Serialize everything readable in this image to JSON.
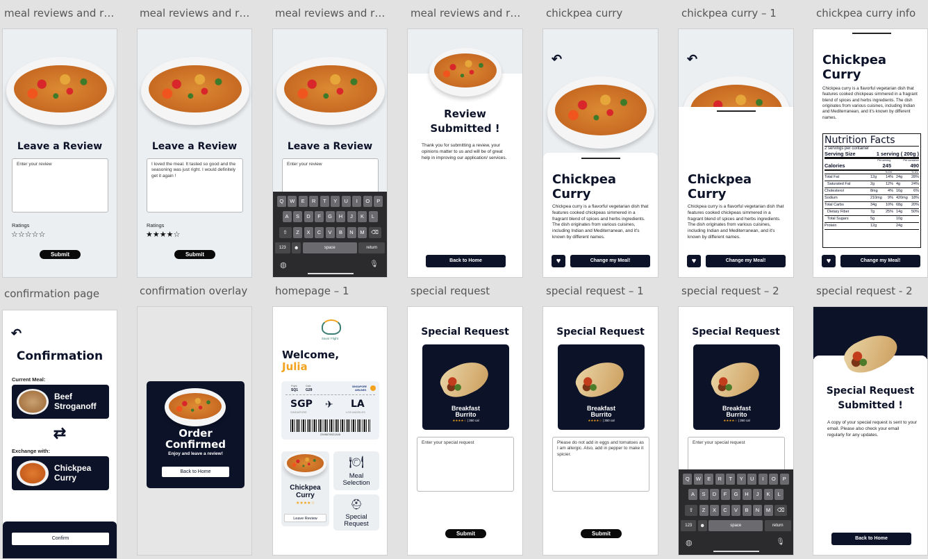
{
  "labels": {
    "r1": [
      "meal reviews and rati...",
      "meal reviews and rati...",
      "meal reviews and rati...",
      "meal reviews and rati...",
      "chickpea curry",
      "chickpea curry – 1",
      "chickpea curry info"
    ],
    "r2": [
      "confirmation page",
      "confirmation overlay",
      "homepage – 1",
      "special request",
      "special request – 1",
      "special request – 2",
      "special request - 2"
    ]
  },
  "review": {
    "title": "Leave a Review",
    "placeholder": "Enter your review",
    "filled_text": "I loved the meal. It tasted so good and the seasoning was just right. I would definitely get it again !",
    "ratings_label": "Ratings",
    "stars_empty": "☆☆☆☆☆",
    "stars_filled": "★★★★☆",
    "submit": "Submit"
  },
  "keyboard": {
    "row1": [
      "Q",
      "W",
      "E",
      "R",
      "T",
      "Y",
      "U",
      "I",
      "O",
      "P"
    ],
    "row2": [
      "A",
      "S",
      "D",
      "F",
      "G",
      "H",
      "J",
      "K",
      "L"
    ],
    "row3": [
      "Z",
      "X",
      "C",
      "V",
      "B",
      "N",
      "M"
    ],
    "num": "123",
    "space": "space",
    "return": "return"
  },
  "submitted": {
    "title_line1": "Review",
    "title_line2": "Submitted !",
    "body": "Thank you for submitting a review, your opinions matter to us and will be of great help in improving our application/ services.",
    "back": "Back to Home"
  },
  "curry": {
    "title_line1": "Chickpea",
    "title_line2": "Curry",
    "desc": "Chickpea curry is a flavorful vegetarian dish that features cooked chickpeas simmered in a fragrant blend of spices and herbs ingredients. The dish originates from various cuisines, including Indian and Mediterranean, and it's known by different names.",
    "change": "Change my Meal!",
    "heart": "♥"
  },
  "nutrition": {
    "title": "Nutrition Facts",
    "servings": "2 servings per container",
    "serving_size_label": "Serving Size",
    "serving_size_value": "1 serving ( 200g )",
    "per_serving": "Per serving",
    "per_container": "Per container",
    "calories_label": "Calories",
    "calories_a": "245",
    "calories_b": "490",
    "dv": "% DV",
    "rows": [
      [
        "Total Fat",
        "12g",
        "14%",
        "24g",
        "28%"
      ],
      [
        "Saturated Fat",
        "2g",
        "12%",
        "4g",
        "24%"
      ],
      [
        "Cholesterol",
        "8mg",
        "4%",
        "16g",
        "6%"
      ],
      [
        "Sodium",
        "210mg",
        "9%",
        "420mg",
        "18%"
      ],
      [
        "Total Carbs",
        "34g",
        "10%",
        "68g",
        "20%"
      ],
      [
        "Dietary Fiber",
        "7g",
        "25%",
        "14g",
        "50%"
      ],
      [
        "Total Sugars",
        "5g",
        "",
        "10g",
        ""
      ],
      [
        "Protein",
        "12g",
        "",
        "24g",
        ""
      ]
    ]
  },
  "confirmation": {
    "title": "Confirmation",
    "current_label": "Current Meal:",
    "current_meal_l1": "Beef",
    "current_meal_l2": "Stroganoff",
    "exchange_label": "Exchange with:",
    "exchange_meal_l1": "Chickpea",
    "exchange_meal_l2": "Curry",
    "swap_icon": "⇄",
    "confirm": "Confirm"
  },
  "overlay": {
    "title_l1": "Order",
    "title_l2": "Confirmed",
    "sub": "Enjoy and leave a review!",
    "back": "Back to Home"
  },
  "home": {
    "brand": "Savor Flight",
    "welcome": "Welcome,",
    "name": "Julia",
    "flight_label": "Flight",
    "flight": "SQ1",
    "gate_label": "Gate",
    "gate": "G29",
    "airline_l1": "SINGAPORE",
    "airline_l2": "AIRLINES",
    "from_code": "SGP",
    "from_city": "SINGAPORE",
    "to_code": "LA",
    "to_city": "LOS ANGELES",
    "barcode_num": "2345678921345",
    "meal_name_l1": "Chickpea",
    "meal_name_l2": "Curry",
    "meal_stars": "★★★★☆",
    "leave_review": "Leave Review",
    "meal_sel_l1": "Meal",
    "meal_sel_l2": "Selection",
    "special_l1": "Special",
    "special_l2": "Request"
  },
  "special": {
    "title": "Special Request",
    "card_l1": "Breakfast",
    "card_l2": "Burrito",
    "card_stars": "★★★★☆",
    "card_kcal": "| 350 cal",
    "placeholder": "Enter your special request",
    "filled": "Please do not add in eggs and tomatoes as I am allergic. Also, add in pepper to make it spicier.",
    "submit": "Submit",
    "sub_title_l1": "Special Request",
    "sub_title_l2": "Submitted !",
    "sub_body": "A copy of your special request is sent to your email. Please also check your email regularly for any updates.",
    "back": "Back to Home"
  },
  "colors": {
    "navy": "#0c1228",
    "accent_orange": "#f2a21c",
    "canvas": "#e2e2e2"
  }
}
